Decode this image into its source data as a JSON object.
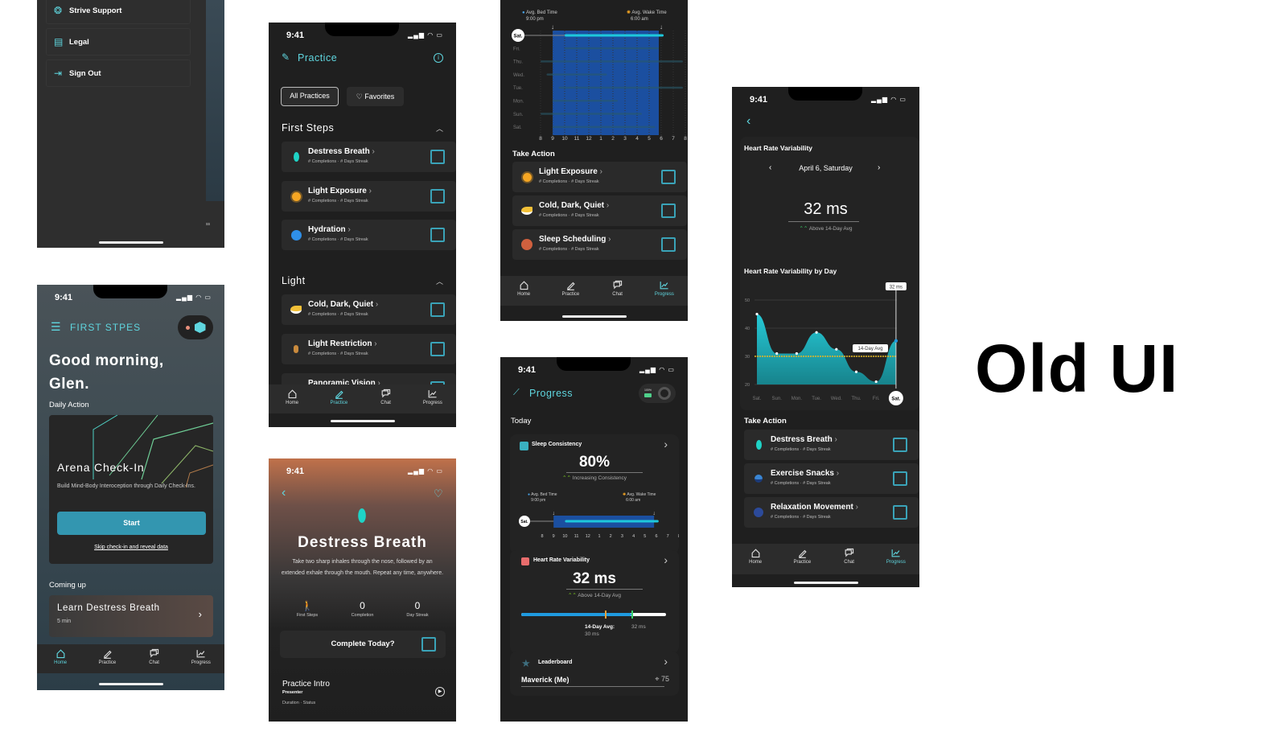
{
  "label": "Old UI",
  "status": {
    "time": "9:41"
  },
  "nav": [
    "Home",
    "Practice",
    "Chat",
    "Progress"
  ],
  "item_meta": {
    "completions": "# Completions",
    "streak": "# Days Streak"
  },
  "menu": {
    "items": [
      {
        "label": "Strive Support",
        "icon": "lifebuoy-icon"
      },
      {
        "label": "Legal",
        "icon": "document-icon"
      },
      {
        "label": "Sign Out",
        "icon": "sign-out-icon"
      }
    ],
    "partial_text": "ss"
  },
  "home": {
    "brand": "FIRST STPES",
    "greeting_line1": "Good morning,",
    "greeting_line2": "Glen.",
    "daily_action": "Daily Action",
    "checkin": {
      "title": "Arena Check-In",
      "desc": "Build Mind-Body Interoception through Daily Check-Ins.",
      "start": "Start",
      "skip": "Skip check-in and reveal data"
    },
    "coming_up": "Coming up",
    "upcoming": {
      "title": "Learn Destress Breath",
      "duration": "5 min"
    }
  },
  "practice": {
    "title": "Practice",
    "filters": [
      "All Practices",
      "Favorites"
    ],
    "sections": [
      {
        "title": "First Steps",
        "items": [
          {
            "name": "Destress Breath",
            "icon": "leaf-icon",
            "color": "#1fd3c6"
          },
          {
            "name": "Light Exposure",
            "icon": "sun-icon",
            "color": "#f5a623"
          },
          {
            "name": "Hydration",
            "icon": "water-circle-icon",
            "color": "#2f8fe8"
          }
        ]
      },
      {
        "title": "Light",
        "items": [
          {
            "name": "Cold, Dark, Quiet",
            "icon": "moon-cloud-icon",
            "color": "#f2c037"
          },
          {
            "name": "Light Restriction",
            "icon": "lantern-icon",
            "color": "#c98a3d"
          },
          {
            "name": "Panoramic Vision",
            "icon": "panorama-icon",
            "color": "#c98a3d"
          }
        ]
      }
    ]
  },
  "detail": {
    "title": "Destress Breath",
    "desc": "Take two sharp inhales through the nose, followed by an extended exhale through the mouth. Repeat any time, anywhere.",
    "stats": [
      {
        "value": "",
        "label": "First Steps",
        "icon": "walking-figure-icon"
      },
      {
        "value": "0",
        "label": "Completion"
      },
      {
        "value": "0",
        "label": "Day Streak"
      }
    ],
    "complete": "Complete Today?",
    "intro": {
      "title": "Practice Intro",
      "presenter": "Presenter",
      "meta": "Duration  ·  Status"
    }
  },
  "sleep": {
    "bed_label": "Avg. Bed Time",
    "bed_time": "9:00 pm",
    "wake_label": "Avg. Wake Time",
    "wake_time": "6:00 am",
    "take_action": "Take Action",
    "items": [
      {
        "name": "Light Exposure",
        "icon": "sun-icon",
        "color": "#f5a623"
      },
      {
        "name": "Cold, Dark, Quiet",
        "icon": "moon-cloud-icon",
        "color": "#f2c037"
      },
      {
        "name": "Sleep Scheduling",
        "icon": "clock-icon",
        "color": "#d0603e"
      }
    ]
  },
  "progress": {
    "title": "Progress",
    "battery": "100%",
    "today": "Today",
    "sleep_card": {
      "title": "Sleep Consistency",
      "value": "80%",
      "trend": "Increasing Consistency"
    },
    "hrv_card": {
      "title": "Heart Rate Variability",
      "value": "32 ms",
      "trend": "Above 14-Day Avg",
      "avg_label": "14-Day Avg:",
      "avg_value": "30 ms",
      "current": "32 ms",
      "avg_fraction": 0.58,
      "current_fraction": 0.76
    },
    "leaderboard": {
      "title": "Leaderboard",
      "name": "Maverick (Me)",
      "score": "75"
    }
  },
  "hrv": {
    "title": "Heart Rate Variability",
    "date": "April 6, Saturday",
    "value": "32 ms",
    "trend": "Above 14-Day Avg",
    "chart_title": "Heart Rate Variability by Day",
    "take_action": "Take Action",
    "items": [
      {
        "name": "Destress Breath",
        "icon": "leaf-icon",
        "color": "#1fd3c6"
      },
      {
        "name": "Exercise Snacks",
        "icon": "exercise-icon",
        "color": "#3a86d4"
      },
      {
        "name": "Relaxation Movement",
        "icon": "dark-circle-icon",
        "color": "#2c4a9a"
      }
    ]
  },
  "chart_data": [
    {
      "type": "area",
      "categories": [
        "Sat.",
        "Sun.",
        "Mon.",
        "Tue.",
        "Wed.",
        "Thu.",
        "Fri.",
        "Sat."
      ],
      "values": [
        45,
        31,
        31,
        38.5,
        32.5,
        24.5,
        21,
        35.5
      ],
      "ylim": [
        20,
        50
      ],
      "yticks": [
        20,
        30,
        40,
        50
      ],
      "reference_line": {
        "label": "14-Day Avg",
        "value": 30,
        "color": "#e8b923"
      },
      "tooltip": "32 ms",
      "color": "#26c9d6"
    },
    {
      "type": "bar",
      "orientation": "horizontal",
      "categories": [
        "Sat.",
        "Fri.",
        "Thu.",
        "Wed.",
        "Tue.",
        "Mon.",
        "Sun.",
        "Sat."
      ],
      "x_ticks": [
        "8",
        "9",
        "10",
        "11",
        "12",
        "1",
        "2",
        "3",
        "4",
        "5",
        "6",
        "7",
        "8"
      ],
      "start_hour_index": [
        2,
        2,
        0,
        0.5,
        1.5,
        1,
        0,
        1
      ],
      "end_hour_index": [
        10.2,
        9.8,
        11.8,
        5.5,
        11.8,
        6.4,
        8.4,
        9.5
      ],
      "avg_window": [
        1,
        9.8
      ],
      "color": "#1ec8dc"
    }
  ]
}
